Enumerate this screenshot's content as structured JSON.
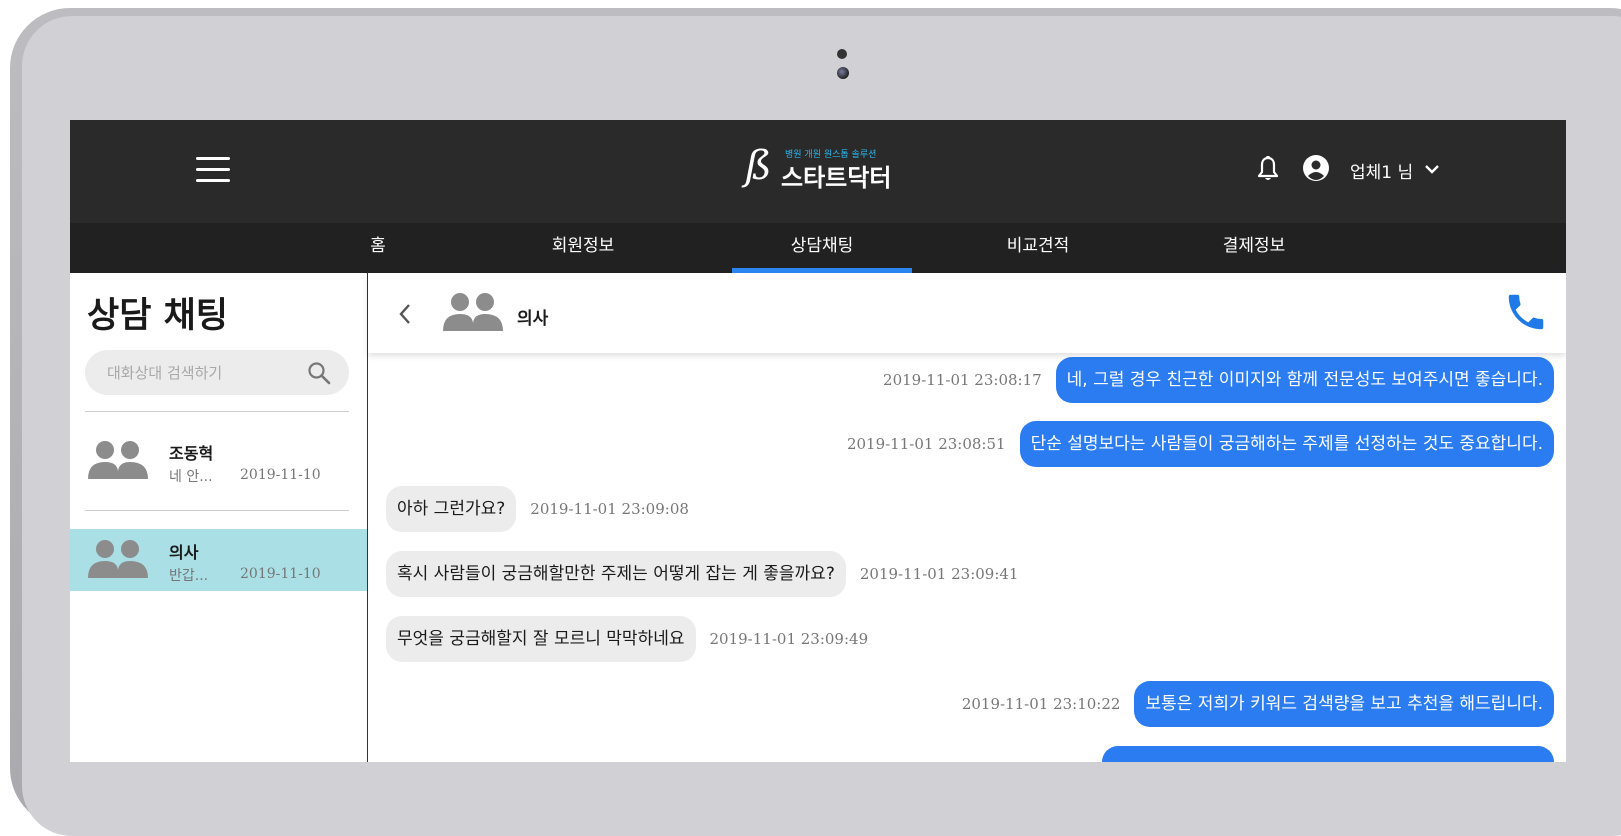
{
  "header": {
    "logo_mark": "ß",
    "logo_tagline": "병원 개원 원스톱 솔루션",
    "logo_name": "스타트닥터",
    "user_name": "업체1 님",
    "icons": [
      "menu-icon",
      "bell-icon",
      "user-circle-icon",
      "chevron-down-icon"
    ]
  },
  "nav": {
    "items": [
      {
        "label": "홈"
      },
      {
        "label": "회원정보"
      },
      {
        "label": "상담채팅"
      },
      {
        "label": "비교견적"
      },
      {
        "label": "결제정보"
      }
    ],
    "active_index": 2,
    "accent": "#2b86f0"
  },
  "sidebar": {
    "title": "상담 채팅",
    "search_placeholder": "대화상대 검색하기",
    "search_value": "",
    "conversations": [
      {
        "name": "조동혁",
        "preview": "네 안...",
        "date": "2019-11-10",
        "active": false
      },
      {
        "name": "의사",
        "preview": "반갑...",
        "date": "2019-11-10",
        "active": true
      }
    ],
    "active_color": "#a9dfe5"
  },
  "chat": {
    "contact_name": "의사",
    "messages": [
      {
        "dir": "out",
        "text": "네, 그럴 경우 친근한 이미지와 함께 전문성도 보여주시면 좋습니다.",
        "time": "2019-11-01 23:08:17"
      },
      {
        "dir": "out",
        "text": "단순 설명보다는 사람들이 궁금해하는 주제를 선정하는 것도 중요합니다.",
        "time": "2019-11-01 23:08:51"
      },
      {
        "dir": "in",
        "text": "아하 그런가요?",
        "time": "2019-11-01 23:09:08"
      },
      {
        "dir": "in",
        "text": "혹시 사람들이 궁금해할만한 주제는 어떻게 잡는 게 좋을까요?",
        "time": "2019-11-01 23:09:41"
      },
      {
        "dir": "in",
        "text": "무엇을 궁금해할지 잘 모르니 막막하네요",
        "time": "2019-11-01 23:09:49"
      },
      {
        "dir": "out",
        "text": "보통은 저희가 키워드 검색량을 보고 추천을 해드립니다.",
        "time": "2019-11-01 23:10:22"
      }
    ],
    "outgoing_color": "#2b7cf0",
    "incoming_color": "#ececec"
  }
}
